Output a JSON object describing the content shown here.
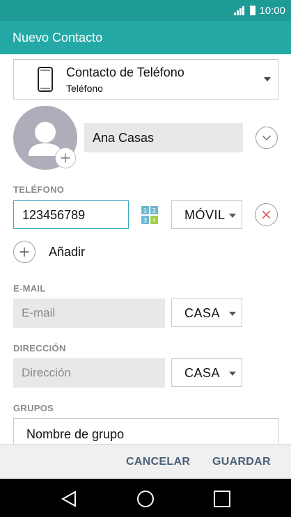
{
  "status_bar": {
    "time": "10:00",
    "icons": [
      "signal-icon",
      "battery-icon"
    ]
  },
  "app_bar": {
    "title": "Nuevo Contacto"
  },
  "account": {
    "name": "Contacto de Teléfono",
    "type": "Teléfono",
    "icon": "phone-icon"
  },
  "contact": {
    "name": "Ana Casas"
  },
  "phone_section": {
    "label": "TELÉFONO",
    "value": "123456789",
    "type": "MÓVIL",
    "dialpad_digits": [
      "1",
      "2",
      "3",
      "⚡"
    ]
  },
  "add_field": {
    "label": "Añadir"
  },
  "email_section": {
    "label": "E-MAIL",
    "placeholder": "E-mail",
    "type": "CASA"
  },
  "address_section": {
    "label": "DIRECCIÓN",
    "placeholder": "Dirección",
    "type": "CASA"
  },
  "groups_section": {
    "label": "GRUPOS",
    "value": "Nombre de grupo"
  },
  "actions": {
    "cancel": "CANCELAR",
    "save": "GUARDAR"
  },
  "colors": {
    "status_bar": "#1e9a97",
    "app_bar": "#25a9a6",
    "focus_border": "#3aa9c1",
    "remove": "#e05555",
    "action_text": "#4a6077"
  }
}
